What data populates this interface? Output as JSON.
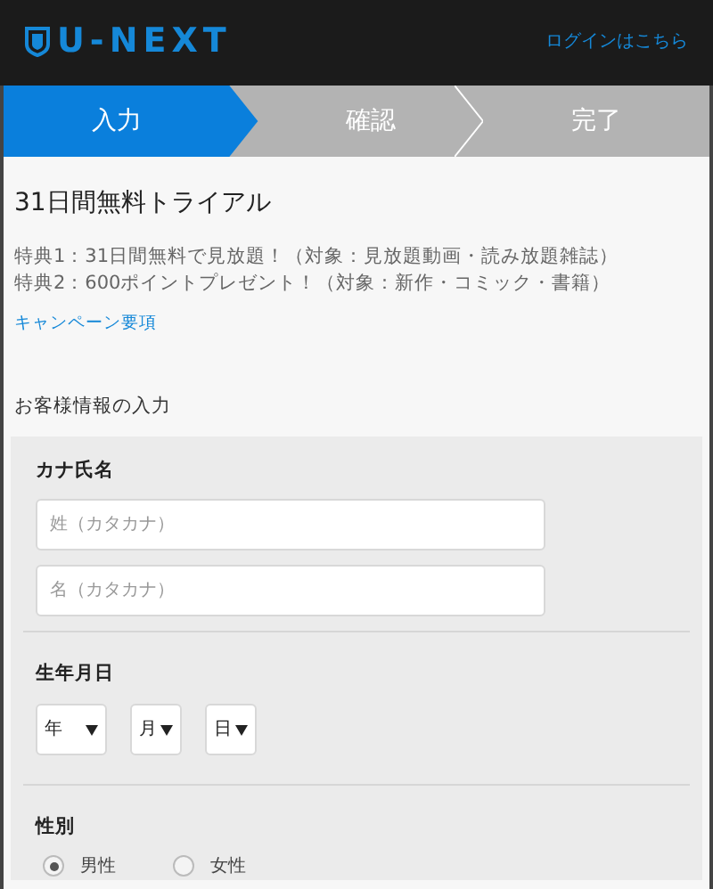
{
  "header": {
    "logo": "U-NEXT",
    "login_link": "ログインはこちら"
  },
  "steps": [
    {
      "label": "入力",
      "selected": true
    },
    {
      "label": "確認",
      "selected": false
    },
    {
      "label": "完了",
      "selected": false
    }
  ],
  "plan": {
    "title": "31日間無料トライアル",
    "benefits": [
      "特典1：31日間無料で見放題！（対象：見放題動画・読み放題雑誌）",
      "特典2：600ポイントプレゼント！（対象：新作・コミック・書籍）"
    ],
    "terms_link": "キャンペーン要項"
  },
  "form": {
    "heading": "お客様情報の入力",
    "kana": {
      "label": "カナ氏名",
      "fields": [
        {
          "placeholder": "姓（カタカナ）"
        },
        {
          "placeholder": "名（カタカナ）"
        }
      ]
    },
    "birthdate": {
      "label": "生年月日",
      "selects": [
        {
          "value": "年"
        },
        {
          "value": "月"
        },
        {
          "value": "日"
        }
      ]
    },
    "gender": {
      "label": "性別",
      "options": [
        {
          "label": "男性",
          "selected": true
        },
        {
          "label": "女性",
          "selected": false
        }
      ]
    }
  }
}
